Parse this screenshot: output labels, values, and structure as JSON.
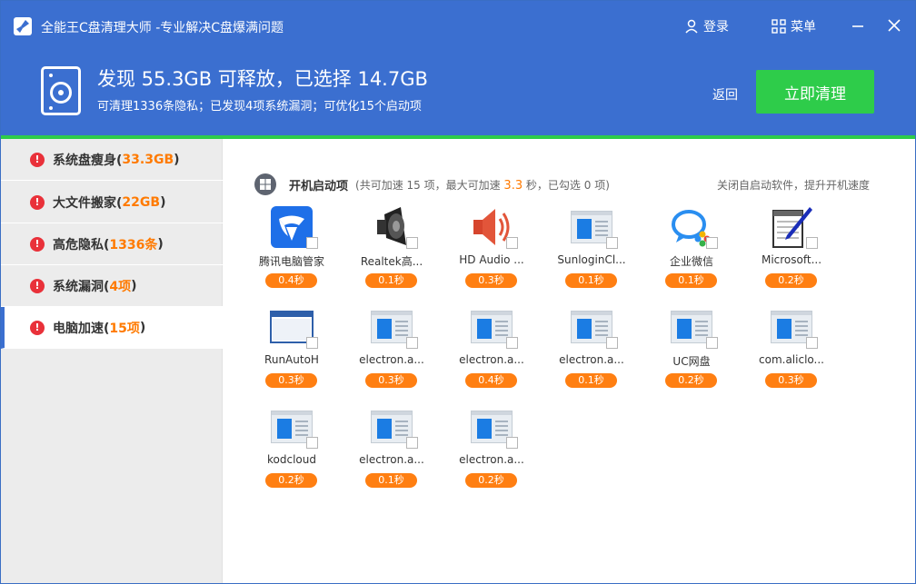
{
  "window": {
    "title": "全能王C盘清理大师 -专业解决C盘爆满问题",
    "login_label": "登录",
    "menu_label": "菜单"
  },
  "summary": {
    "headline": "发现 55.3GB 可释放，已选择 14.7GB",
    "subline": "可清理1336条隐私；已发现4项系统漏洞；可优化15个启动项",
    "back_label": "返回",
    "clean_label": "立即清理"
  },
  "sidebar": {
    "items": [
      {
        "label": "系统盘瘦身(",
        "count": "33.3GB",
        "close": ")"
      },
      {
        "label": "大文件搬家(",
        "count": "22GB",
        "close": ")"
      },
      {
        "label": "高危隐私(",
        "count": "1336条",
        "close": ")"
      },
      {
        "label": "系统漏洞(",
        "count": "4项",
        "close": ")"
      },
      {
        "label": "电脑加速(",
        "count": "15项",
        "close": ")"
      }
    ]
  },
  "section": {
    "title": "开机启动项",
    "info_prefix": "(共可加速 15 项，最大可加速 ",
    "info_highlight": "3.3",
    "info_suffix": " 秒，已勾选 0 项)",
    "right_note": "关闭自启动软件，提升开机速度"
  },
  "colors": {
    "header_blue": "#3b6fd0",
    "accent_green": "#2ecc4a",
    "badge_orange": "#ff7f12",
    "warn_red": "#e9313a"
  },
  "startup_items": [
    {
      "name": "腾讯电脑管家",
      "time": "0.4秒",
      "icon": "tencent-pc-manager-icon"
    },
    {
      "name": "Realtek高...",
      "time": "0.1秒",
      "icon": "speaker-icon"
    },
    {
      "name": "HD Audio ...",
      "time": "0.3秒",
      "icon": "audio-volume-icon"
    },
    {
      "name": "SunloginCl...",
      "time": "0.1秒",
      "icon": "generic-app-icon"
    },
    {
      "name": "企业微信",
      "time": "0.1秒",
      "icon": "wecom-icon"
    },
    {
      "name": "Microsoft...",
      "time": "0.2秒",
      "icon": "notepad-pen-icon"
    },
    {
      "name": "RunAutoH",
      "time": "0.3秒",
      "icon": "window-icon"
    },
    {
      "name": "electron.a...",
      "time": "0.3秒",
      "icon": "generic-app-icon"
    },
    {
      "name": "electron.a...",
      "time": "0.4秒",
      "icon": "generic-app-icon"
    },
    {
      "name": "electron.a...",
      "time": "0.1秒",
      "icon": "generic-app-icon"
    },
    {
      "name": "UC网盘",
      "time": "0.2秒",
      "icon": "generic-app-icon"
    },
    {
      "name": "com.aliclo...",
      "time": "0.3秒",
      "icon": "generic-app-icon"
    },
    {
      "name": "kodcloud",
      "time": "0.2秒",
      "icon": "generic-app-icon"
    },
    {
      "name": "electron.a...",
      "time": "0.1秒",
      "icon": "generic-app-icon"
    },
    {
      "name": "electron.a...",
      "time": "0.2秒",
      "icon": "generic-app-icon"
    }
  ]
}
